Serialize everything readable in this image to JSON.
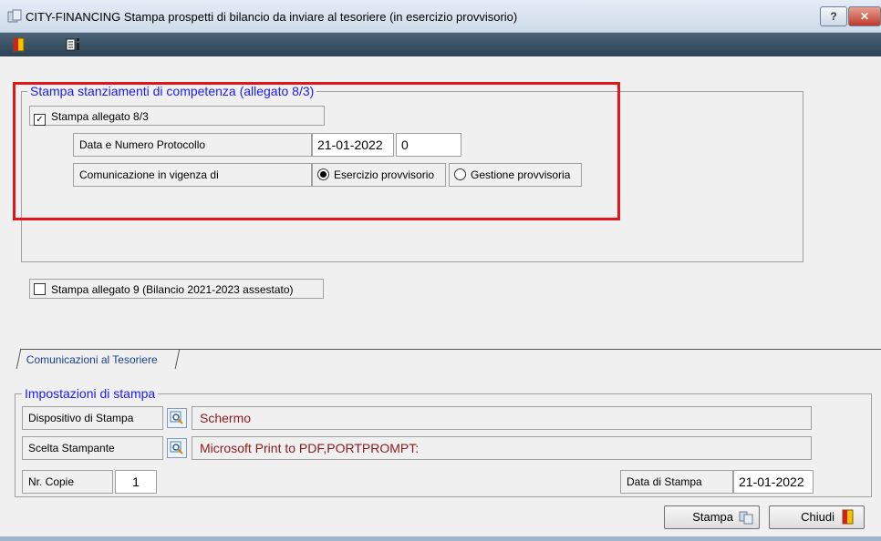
{
  "window": {
    "title": "CITY-FINANCING  Stampa prospetti di bilancio da inviare al tesoriere (in esercizio provvisorio)",
    "help_label": "?",
    "close_label": "✕"
  },
  "section1": {
    "legend": "Stampa stanziamenti di competenza (allegato 8/3)",
    "checkbox_label": "Stampa allegato 8/3",
    "checked": true,
    "protocol_label": "Data e Numero Protocollo",
    "protocol_date": "21-01-2022",
    "protocol_number": "0",
    "vigenza_label": "Comunicazione in vigenza di",
    "options": [
      {
        "label": "Esercizio provvisorio",
        "selected": true
      },
      {
        "label": "Gestione provvisoria",
        "selected": false
      }
    ]
  },
  "section2": {
    "checkbox_label": "Stampa allegato 9  (Bilancio 2021-2023 assestato)",
    "checked": false
  },
  "tab": {
    "label": "Comunicazioni al Tesoriere"
  },
  "print_settings": {
    "legend": "Impostazioni di stampa",
    "device_label": "Dispositivo di Stampa",
    "device_value": "Schermo",
    "printer_label": "Scelta Stampante",
    "printer_value": "Microsoft Print to PDF,PORTPROMPT:",
    "copies_label": "Nr. Copie",
    "copies_value": "1",
    "date_label": "Data di Stampa",
    "date_value": "21-01-2022"
  },
  "buttons": {
    "print_label": "Stampa",
    "close_label": "Chiudi"
  },
  "colors": {
    "legend_text": "#1a1aff",
    "highlight_box": "#e0161b",
    "value_text": "#8b1a1a"
  }
}
